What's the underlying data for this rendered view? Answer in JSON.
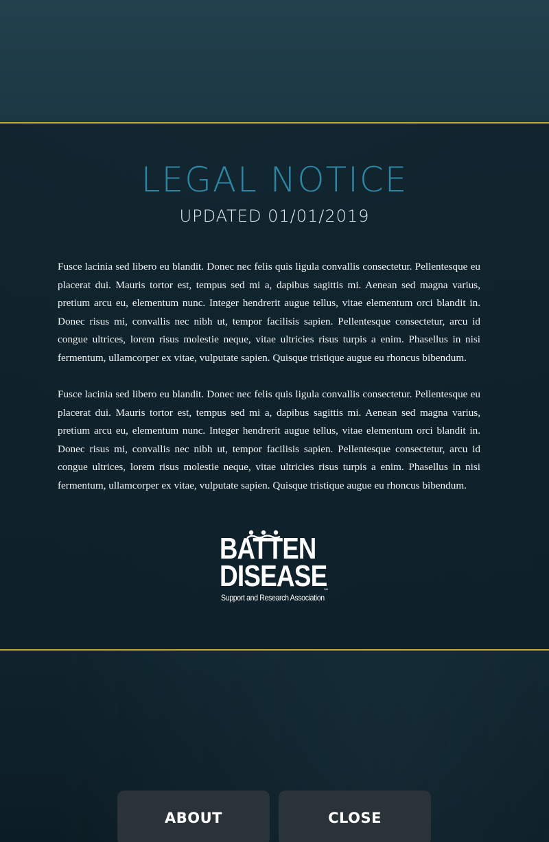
{
  "header": {
    "title": "LEGAL NOTICE",
    "updated": "UPDATED 01/01/2019"
  },
  "body": {
    "paragraphs": [
      "Fusce lacinia sed libero eu blandit. Donec nec felis quis ligula convallis consectetur. Pellentesque eu placerat dui. Mauris tortor est, tempus sed mi a, dapibus sagittis mi. Aenean sed magna varius, pretium arcu eu, elementum nunc. Integer hendrerit augue tellus, vitae elementum orci blandit in. Donec risus mi, convallis nec nibh ut, tempor facilisis sapien. Pellentesque consectetur, arcu id congue ultrices, lorem risus molestie neque, vitae ultricies risus turpis a enim. Phasellus in nisi fermentum, ullamcorper ex vitae, vulputate sapien. Quisque tristique augue eu rhoncus bibendum.",
      "Fusce lacinia sed libero eu blandit. Donec nec felis quis ligula convallis consectetur. Pellentesque eu placerat dui. Mauris tortor est, tempus sed mi a, dapibus sagittis mi. Aenean sed magna varius, pretium arcu eu, elementum nunc. Integer hendrerit augue tellus, vitae elementum orci blandit in. Donec risus mi, convallis nec nibh ut, tempor facilisis sapien. Pellentesque consectetur, arcu id congue ultrices, lorem risus molestie neque, vitae ultricies risus turpis a enim. Phasellus in nisi fermentum, ullamcorper ex vitae, vulputate sapien. Quisque tristique augue eu rhoncus bibendum."
    ]
  },
  "logo": {
    "line1": "BATTEN",
    "line2": "DISEASE",
    "tagline": "Support and Research Association",
    "mark": "SM"
  },
  "buttons": {
    "about_label": "ABOUT",
    "close_label": "CLOSE"
  },
  "colors": {
    "background": "#142a34",
    "accent_gold": "#c9a73b",
    "title_blue": "#2e86a4",
    "button_bg": "#293338"
  }
}
